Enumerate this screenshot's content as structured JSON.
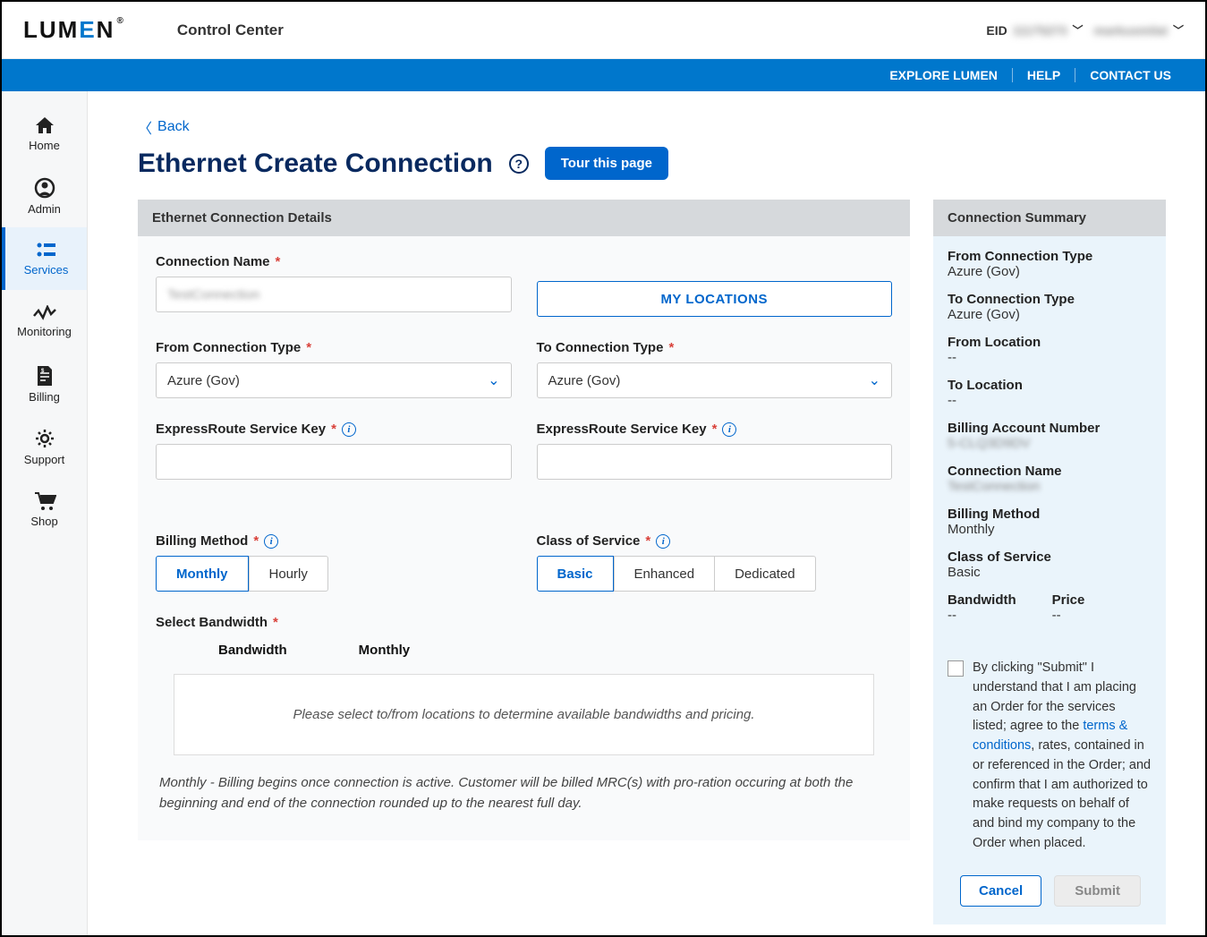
{
  "header": {
    "brand_pre": "LUM",
    "brand_e": "E",
    "brand_post": "N",
    "brand_reg": "®",
    "app_title": "Control Center",
    "eid_label": "EID",
    "eid_value": "11175273",
    "user_name": "markusmilat"
  },
  "ribbon": {
    "explore": "EXPLORE LUMEN",
    "help": "HELP",
    "contact": "CONTACT US"
  },
  "sidenav": [
    {
      "key": "home",
      "label": "Home"
    },
    {
      "key": "admin",
      "label": "Admin"
    },
    {
      "key": "services",
      "label": "Services"
    },
    {
      "key": "monitoring",
      "label": "Monitoring"
    },
    {
      "key": "billing",
      "label": "Billing"
    },
    {
      "key": "support",
      "label": "Support"
    },
    {
      "key": "shop",
      "label": "Shop"
    }
  ],
  "page": {
    "back": "Back",
    "title": "Ethernet Create Connection",
    "tour": "Tour this page"
  },
  "details": {
    "header": "Ethernet Connection Details",
    "connection_name_label": "Connection Name",
    "connection_name_value": "TestConnection",
    "my_locations": "MY LOCATIONS",
    "from_type_label": "From Connection Type",
    "from_type_value": "Azure (Gov)",
    "to_type_label": "To Connection Type",
    "to_type_value": "Azure (Gov)",
    "er_key_from_label": "ExpressRoute Service Key",
    "er_key_to_label": "ExpressRoute Service Key",
    "billing_method_label": "Billing Method",
    "billing_options": {
      "monthly": "Monthly",
      "hourly": "Hourly"
    },
    "cos_label": "Class of Service",
    "cos_options": {
      "basic": "Basic",
      "enhanced": "Enhanced",
      "dedicated": "Dedicated"
    },
    "bandwidth_label": "Select Bandwidth",
    "bw_col1": "Bandwidth",
    "bw_col2": "Monthly",
    "bw_placeholder": "Please select to/from locations to determine available bandwidths and pricing.",
    "note": "Monthly - Billing begins once connection is active. Customer will be billed MRC(s) with pro-ration occuring at both the beginning and end of the connection rounded up to the nearest full day."
  },
  "summary": {
    "header": "Connection Summary",
    "from_type_l": "From Connection Type",
    "from_type_v": "Azure (Gov)",
    "to_type_l": "To Connection Type",
    "to_type_v": "Azure (Gov)",
    "from_loc_l": "From Location",
    "from_loc_v": "--",
    "to_loc_l": "To Location",
    "to_loc_v": "--",
    "ban_l": "Billing Account Number",
    "ban_v": "5-CLQ3D9DV",
    "cn_l": "Connection Name",
    "cn_v": "TestConnection",
    "bm_l": "Billing Method",
    "bm_v": "Monthly",
    "cos_l": "Class of Service",
    "cos_v": "Basic",
    "bw_l": "Bandwidth",
    "bw_v": "--",
    "price_l": "Price",
    "price_v": "--",
    "agree_pre": "By clicking \"Submit\" I understand that I am placing an Order for the services listed; agree to the ",
    "agree_link": "terms & conditions",
    "agree_post": ", rates, contained in or referenced in the Order; and confirm that I am authorized to make requests on behalf of and bind my company to the Order when placed.",
    "cancel": "Cancel",
    "submit": "Submit"
  }
}
